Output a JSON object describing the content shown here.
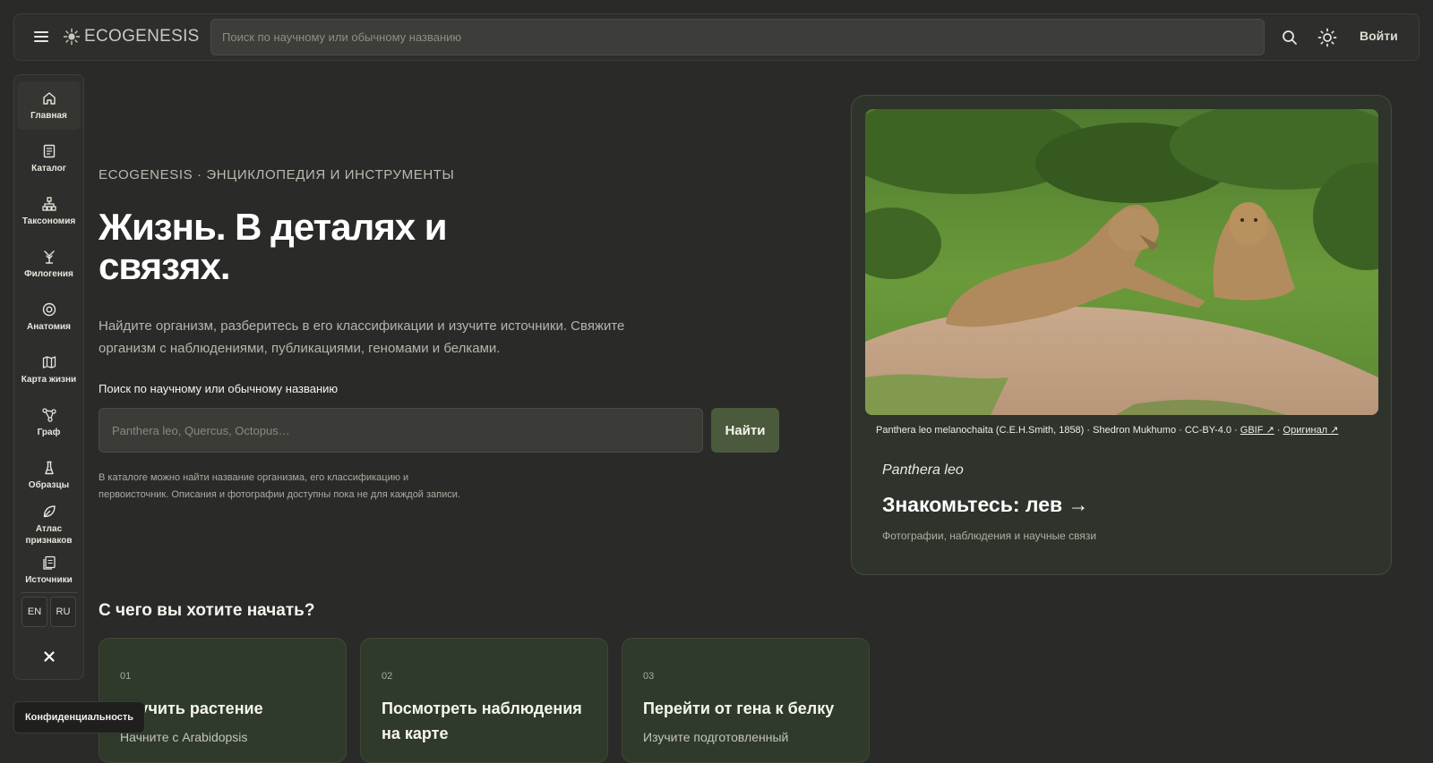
{
  "header": {
    "logo_text": "ECOGENESIS",
    "search_placeholder": "Поиск по научному или обычному названию",
    "login_label": "Войти"
  },
  "sidebar": {
    "items": [
      {
        "label": "Главная",
        "icon": "home-icon"
      },
      {
        "label": "Каталог",
        "icon": "book-icon"
      },
      {
        "label": "Таксономия",
        "icon": "hierarchy-icon"
      },
      {
        "label": "Филогения",
        "icon": "tree-icon"
      },
      {
        "label": "Анатомия",
        "icon": "target-icon"
      },
      {
        "label": "Карта жизни",
        "icon": "map-icon"
      },
      {
        "label": "Граф",
        "icon": "graph-icon"
      },
      {
        "label": "Образцы",
        "icon": "flask-icon"
      },
      {
        "label": "Атлас признаков",
        "icon": "leaf-icon"
      },
      {
        "label": "Источники",
        "icon": "documents-icon"
      }
    ],
    "lang_en": "EN",
    "lang_ru": "RU"
  },
  "hero": {
    "eyebrow": "ECOGENESIS · ЭНЦИКЛОПЕДИЯ И ИНСТРУМЕНТЫ",
    "headline": "Жизнь. В деталях и связях.",
    "lead": "Найдите организм, разберитесь в его классификации и изучите источники. Свяжите организм с наблюдениями, публикациями, геномами и белками.",
    "search_label": "Поиск по научному или обычному названию",
    "search_placeholder": "Panthera leo, Quercus, Octopus…",
    "find_label": "Найти",
    "note": "В каталоге можно найти название организма, его классификацию и первоисточник. Описания и фотографии доступны пока не для каждой записи."
  },
  "start": {
    "title": "С чего вы хотите начать?",
    "cards": [
      {
        "num": "01",
        "title": "Изучить растение",
        "desc": "Начните с Arabidopsis"
      },
      {
        "num": "02",
        "title": "Посмотреть наблюдения на карте",
        "desc": ""
      },
      {
        "num": "03",
        "title": "Перейти от гена к белку",
        "desc": "Изучите подготовленный"
      }
    ]
  },
  "feature": {
    "credit_text": "Panthera leo melanochaita (C.E.H.Smith, 1858) · Shedron Mukhumo · CC-BY-4.0 · ",
    "credit_gbif": "GBIF ↗",
    "credit_sep": " · ",
    "credit_original": "Оригинал ↗",
    "species": "Panthera leo",
    "title": "Знакомьтесь: лев →",
    "subtitle": "Фотографии, наблюдения и научные связи"
  },
  "footer": {
    "privacy_label": "Конфиденциальность"
  },
  "colors": {
    "background": "#2a2a28",
    "accent_button": "#4b5a3c",
    "card_green": "#2f3a2a"
  }
}
